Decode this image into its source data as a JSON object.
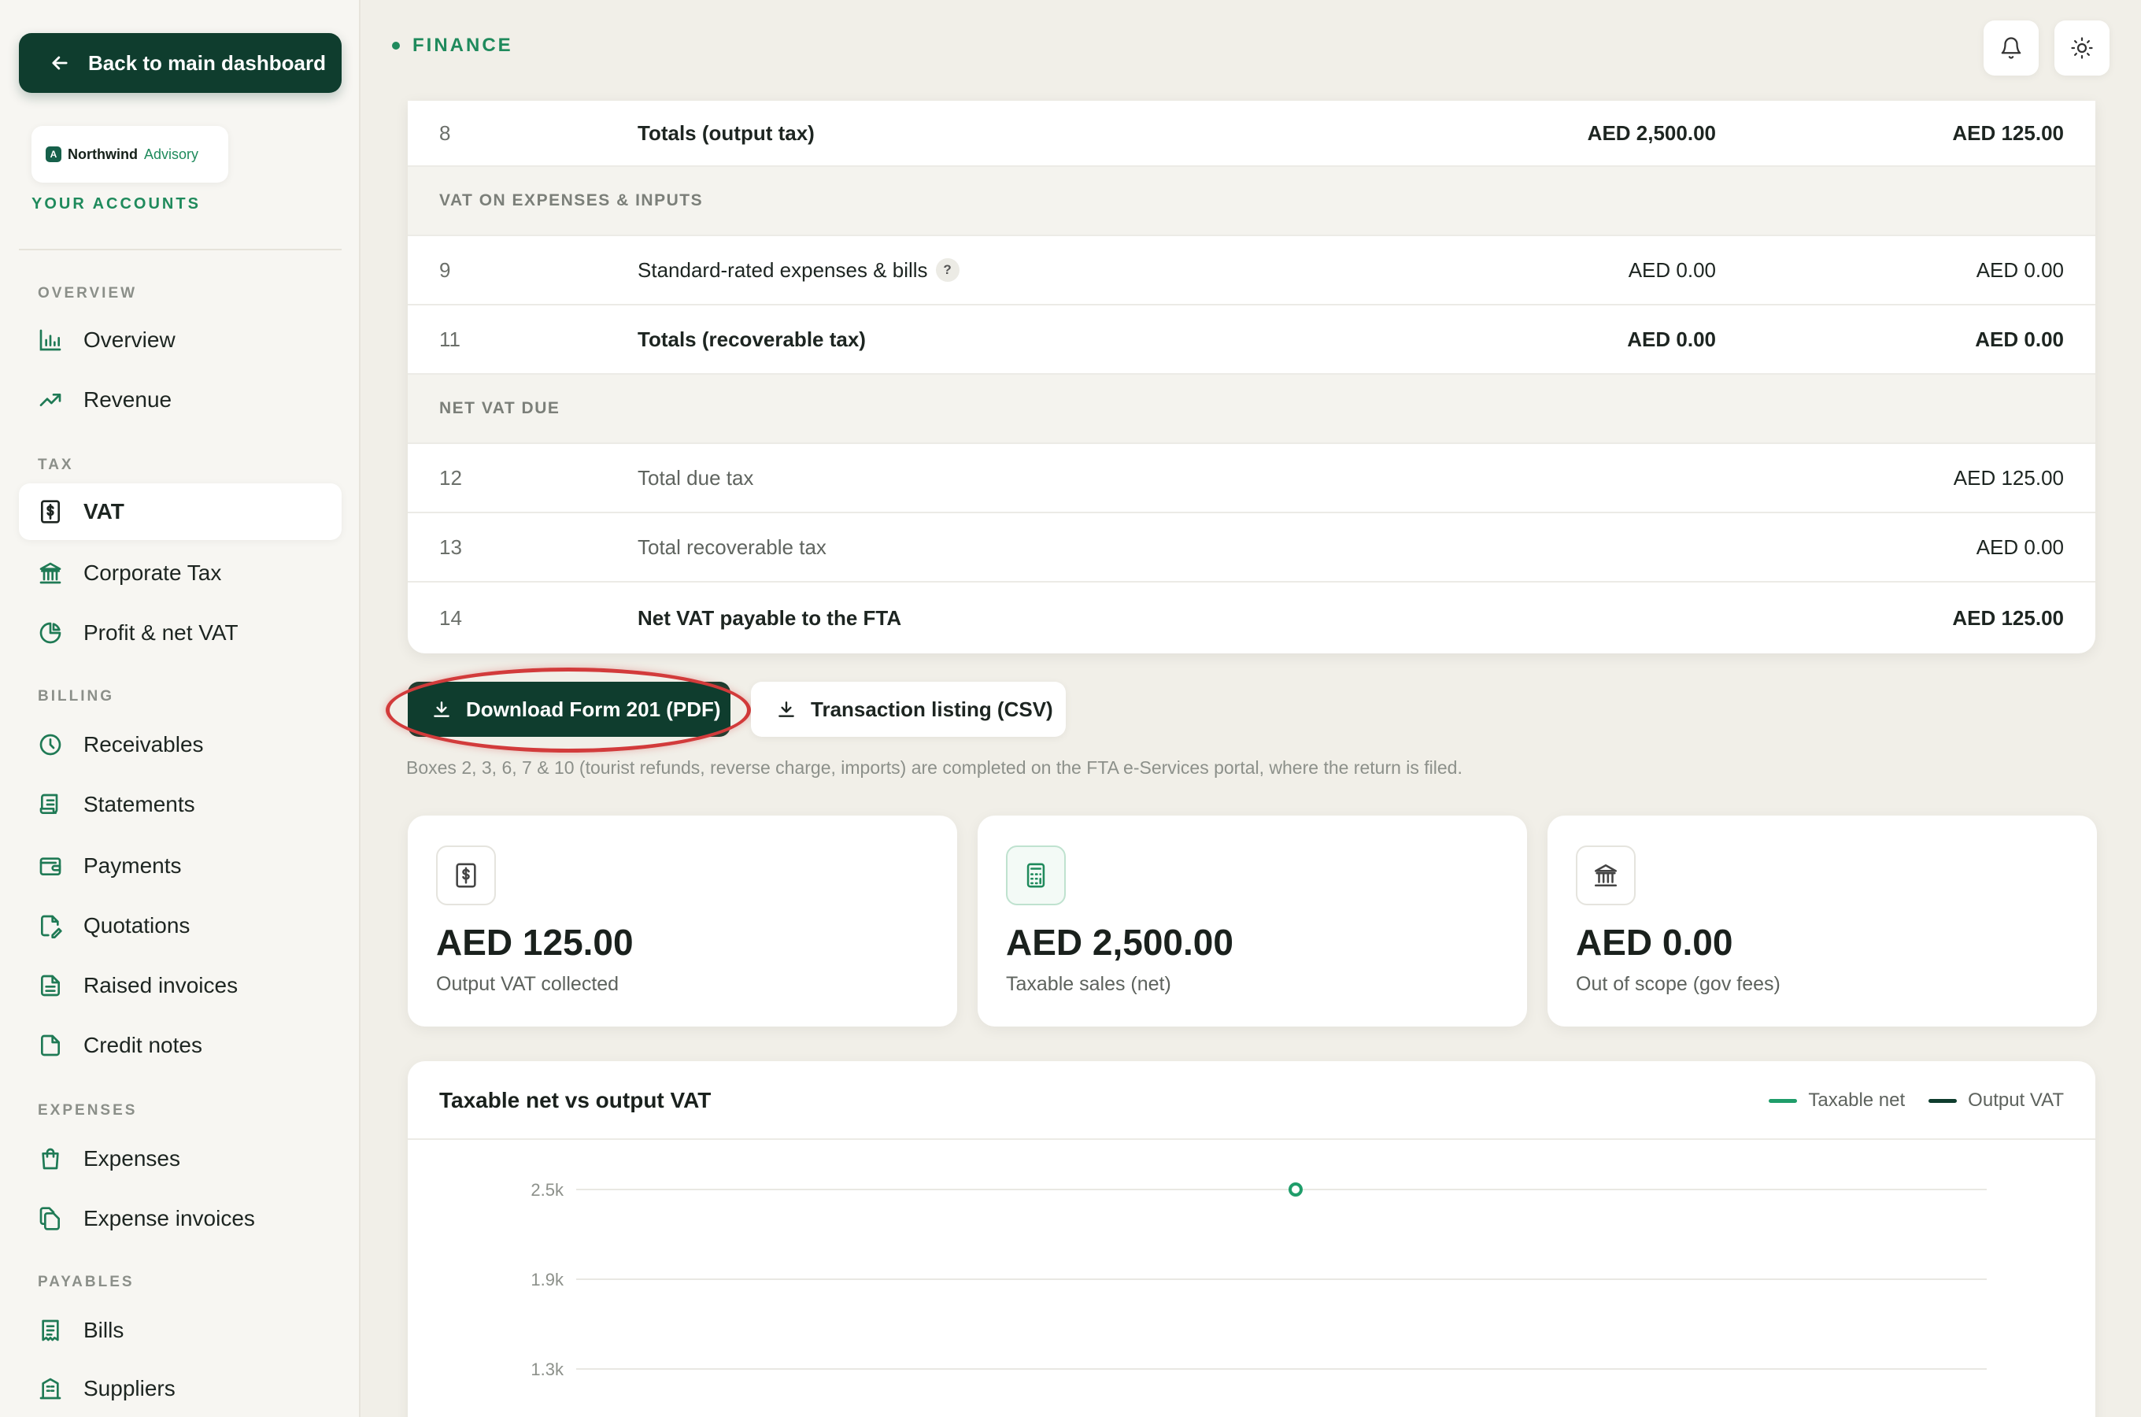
{
  "sidebar": {
    "back_label": "Back to main dashboard",
    "brand": {
      "name": "Northwind",
      "sub": "Advisory",
      "logo_letter": "A"
    },
    "accounts_label": "YOUR ACCOUNTS",
    "sections": {
      "overview": "OVERVIEW",
      "tax": "TAX",
      "billing": "BILLING",
      "expenses": "EXPENSES",
      "payables": "PAYABLES"
    },
    "items": {
      "overview": "Overview",
      "revenue": "Revenue",
      "vat": "VAT",
      "corporate_tax": "Corporate Tax",
      "profit_net_vat": "Profit & net VAT",
      "receivables": "Receivables",
      "statements": "Statements",
      "payments": "Payments",
      "quotations": "Quotations",
      "raised_invoices": "Raised invoices",
      "credit_notes": "Credit notes",
      "expenses": "Expenses",
      "expense_invoices": "Expense invoices",
      "bills": "Bills",
      "suppliers": "Suppliers"
    }
  },
  "header": {
    "section_label": "FINANCE",
    "icons": [
      "bell-icon",
      "sun-icon"
    ]
  },
  "table": {
    "rows": [
      {
        "num": "8",
        "desc": "Totals (output tax)",
        "c1": "AED 2,500.00",
        "c2": "AED 125.00"
      },
      {
        "section": "VAT ON EXPENSES & INPUTS"
      },
      {
        "num": "9",
        "desc": "Standard-rated expenses & bills",
        "help": "?",
        "c1": "AED 0.00",
        "c2": "AED 0.00"
      },
      {
        "num": "11",
        "desc": "Totals (recoverable tax)",
        "c1": "AED 0.00",
        "c2": "AED 0.00"
      },
      {
        "section": "NET VAT DUE"
      },
      {
        "num": "12",
        "desc": "Total due tax",
        "c2": "AED 125.00"
      },
      {
        "num": "13",
        "desc": "Total recoverable tax",
        "c2": "AED 0.00"
      },
      {
        "num": "14",
        "desc": "Net VAT payable to the FTA",
        "c2": "AED 125.00"
      }
    ]
  },
  "actions": {
    "download_pdf": "Download Form 201 (PDF)",
    "transaction_csv": "Transaction listing (CSV)",
    "note": "Boxes 2, 3, 6, 7 & 10 (tourist refunds, reverse charge, imports) are completed on the FTA e-Services portal, where the return is filed."
  },
  "stats": [
    {
      "icon": "receipt-dollar-icon",
      "value": "AED 125.00",
      "label": "Output VAT collected"
    },
    {
      "icon": "calculator-icon",
      "value": "AED 2,500.00",
      "label": "Taxable sales (net)"
    },
    {
      "icon": "bank-icon",
      "value": "AED 0.00",
      "label": "Out of scope (gov fees)"
    }
  ],
  "colors": {
    "accent": "#1f8a5c",
    "dark": "#0f3d2e",
    "highlight": "#d23b3b"
  },
  "chart_data": {
    "type": "line",
    "title": "Taxable net vs output VAT",
    "series": [
      {
        "name": "Taxable net",
        "color": "#1f9d6a",
        "points": [
          {
            "y": 2500
          }
        ]
      },
      {
        "name": "Output VAT",
        "color": "#0f3d2e",
        "points": []
      }
    ],
    "yticks": [
      "2.5k",
      "1.9k",
      "1.3k"
    ],
    "ytick_values": [
      2500,
      1900,
      1300
    ],
    "grid": true,
    "legend": "top-right"
  }
}
